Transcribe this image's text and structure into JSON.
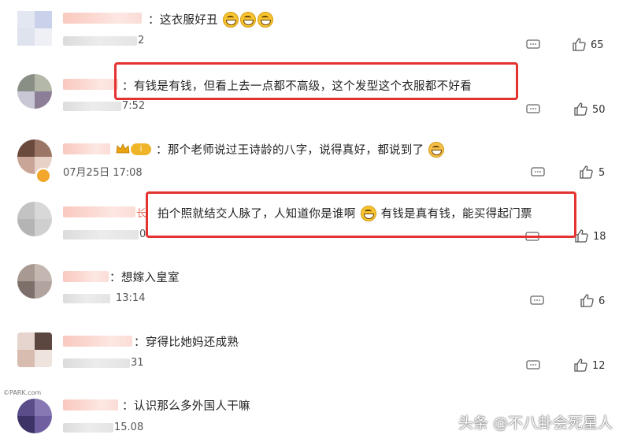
{
  "comments": [
    {
      "text": "这衣服好丑",
      "time": "2",
      "likes": "65",
      "emojis": 3
    },
    {
      "text": "有钱是有钱，但看上去一点都不高级，这个发型这个衣服都不好看",
      "time": "7:52",
      "likes": "50"
    },
    {
      "text": "那个老师说过王诗龄的八字，说得真好，都说到了",
      "time": "07月25日 17:08",
      "likes": "5",
      "badge": "i"
    },
    {
      "text_before": "拍个照就结交人脉了，人知道你是谁啊",
      "text_after": "有钱是真有钱，能买得起门票",
      "time": "0",
      "likes": "18",
      "name_suffix": "长"
    },
    {
      "text": "想嫁入皇室",
      "time": "13:14",
      "likes": "6"
    },
    {
      "text": "穿得比她妈还成熟",
      "time": "31",
      "likes": "12"
    },
    {
      "text": "认识那么多外国人干嘛",
      "time": "15.08",
      "likes": ""
    }
  ],
  "watermark": "头条 @不八卦会死星人",
  "corner_logo": "©PARK.com",
  "colors": {
    "highlight": "#e3322f",
    "name_blur": "#fbd9d2"
  }
}
